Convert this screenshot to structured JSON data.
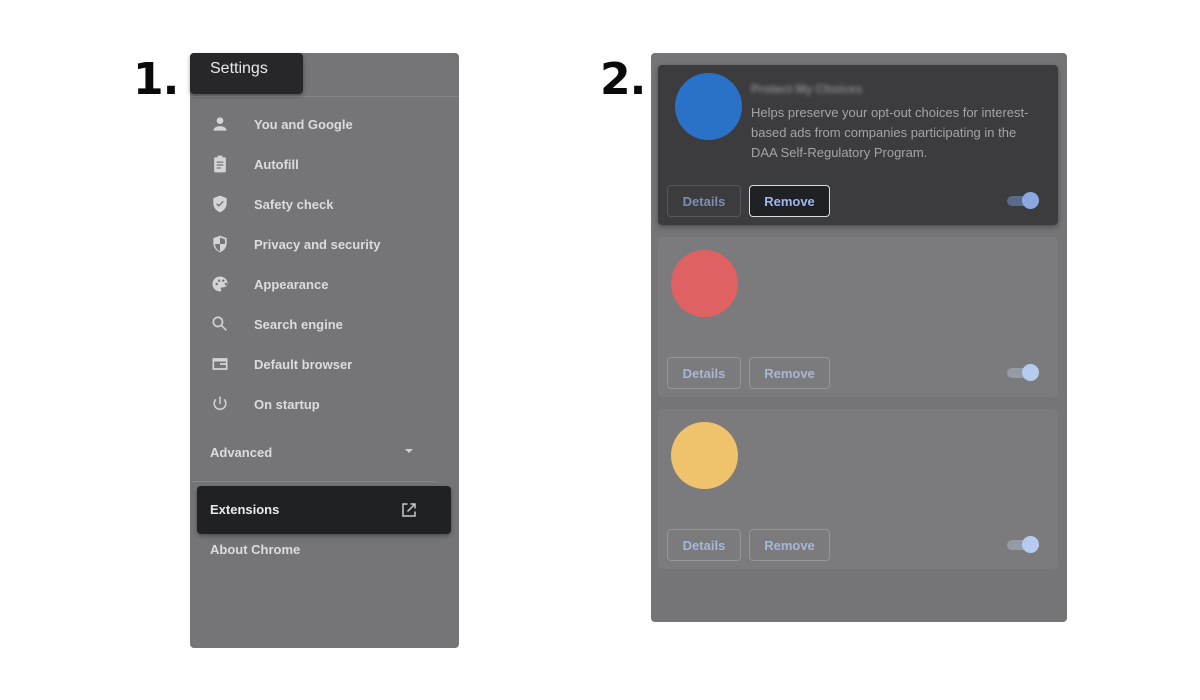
{
  "steps": {
    "step1_label": "1.",
    "step2_label": "2."
  },
  "settings": {
    "title": "Settings",
    "nav_items": [
      {
        "label": "You and Google",
        "icon": "person-icon"
      },
      {
        "label": "Autofill",
        "icon": "clipboard-icon"
      },
      {
        "label": "Safety check",
        "icon": "shield-check-icon"
      },
      {
        "label": "Privacy and security",
        "icon": "shield-half-icon"
      },
      {
        "label": "Appearance",
        "icon": "palette-icon"
      },
      {
        "label": "Search engine",
        "icon": "search-icon"
      },
      {
        "label": "Default browser",
        "icon": "browser-window-icon"
      },
      {
        "label": "On startup",
        "icon": "power-icon"
      }
    ],
    "advanced_label": "Advanced",
    "extensions_label": "Extensions",
    "about_label": "About Chrome"
  },
  "extensions": {
    "cards": [
      {
        "name": "Protect My Choices",
        "description": "Helps preserve your opt-out choices for interest-based ads from companies participating in the DAA Self-Regulatory Program.",
        "logo_color": "#2a72c8",
        "details_label": "Details",
        "remove_label": "Remove",
        "enabled": true
      },
      {
        "name": "",
        "description": "",
        "logo_color": "#e06163",
        "details_label": "Details",
        "remove_label": "Remove",
        "enabled": true
      },
      {
        "name": "",
        "description": "",
        "logo_color": "#efc36c",
        "details_label": "Details",
        "remove_label": "Remove",
        "enabled": true
      }
    ]
  },
  "colors": {
    "panel_bg": "#757577",
    "highlight_bg": "#202124",
    "accent_blue": "#8ab4f8"
  }
}
